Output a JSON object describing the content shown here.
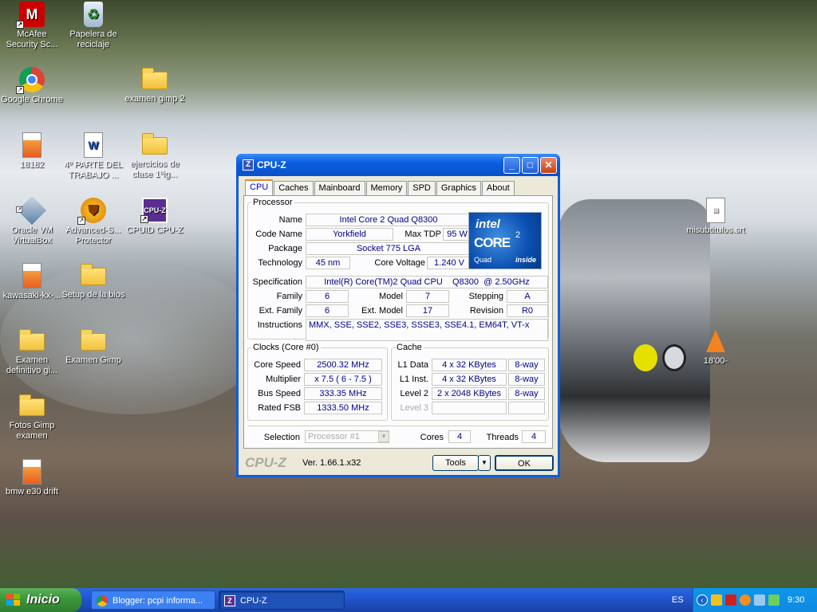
{
  "desktop": {
    "icons": [
      {
        "label": "McAfee Security Sc...",
        "icon": "mcafee-icon"
      },
      {
        "label": "Papelera de reciclaje",
        "icon": "recycle-bin-icon"
      },
      {
        "label": "Google Chrome",
        "icon": "chrome-icon"
      },
      {
        "label": "examen gimp 2",
        "icon": "folder-icon"
      },
      {
        "label": "18182",
        "icon": "image-file-icon"
      },
      {
        "label": "4º PARTE DEL TRABAJO ...",
        "icon": "word-doc-icon"
      },
      {
        "label": "ejercicios de clase 1ºig...",
        "icon": "folder-icon"
      },
      {
        "label": "Oracle VM VirtualBox",
        "icon": "virtualbox-icon"
      },
      {
        "label": "Advanced-S... Protector",
        "icon": "shield-app-icon"
      },
      {
        "label": "CPUID CPU-Z",
        "icon": "cpuz-icon"
      },
      {
        "label": "misubtitulos.srt",
        "icon": "text-file-icon"
      },
      {
        "label": "kawasaki-kx-...",
        "icon": "image-file-icon"
      },
      {
        "label": "Setup de la bios",
        "icon": "folder-icon"
      },
      {
        "label": "18'00-",
        "icon": "vlc-icon"
      },
      {
        "label": "Examen definitivo gi...",
        "icon": "folder-icon"
      },
      {
        "label": "Examen Gimp",
        "icon": "folder-icon"
      },
      {
        "label": "Fotos Gimp examen",
        "icon": "folder-icon"
      },
      {
        "label": "bmw e30 drift",
        "icon": "image-file-icon"
      }
    ]
  },
  "window": {
    "title": "CPU-Z",
    "logo": "Z",
    "tabs": [
      "CPU",
      "Caches",
      "Mainboard",
      "Memory",
      "SPD",
      "Graphics",
      "About"
    ],
    "processor": {
      "legend": "Processor",
      "name_label": "Name",
      "name": "Intel Core 2 Quad Q8300",
      "codename_label": "Code Name",
      "codename": "Yorkfield",
      "maxtdp_label": "Max TDP",
      "maxtdp": "95 W",
      "package_label": "Package",
      "package": "Socket 775 LGA",
      "technology_label": "Technology",
      "technology": "45 nm",
      "voltage_label": "Core Voltage",
      "voltage": "1.240 V",
      "spec_label": "Specification",
      "spec": "Intel(R) Core(TM)2 Quad CPU    Q8300  @ 2.50GHz",
      "family_label": "Family",
      "family": "6",
      "model_label": "Model",
      "model": "7",
      "stepping_label": "Stepping",
      "stepping": "A",
      "extfamily_label": "Ext. Family",
      "extfamily": "6",
      "extmodel_label": "Ext. Model",
      "extmodel": "17",
      "revision_label": "Revision",
      "revision": "R0",
      "instructions_label": "Instructions",
      "instructions": "MMX, SSE, SSE2, SSE3, SSSE3, SSE4.1, EM64T, VT-x"
    },
    "intel_logo": {
      "brand": "intel",
      "line": "CORE",
      "sup": "2",
      "sub": "Quad",
      "inside": "inside"
    },
    "clocks": {
      "legend": "Clocks (Core #0)",
      "corespeed_label": "Core Speed",
      "corespeed": "2500.32 MHz",
      "multiplier_label": "Multiplier",
      "multiplier": "x 7.5 ( 6 - 7.5 )",
      "busspeed_label": "Bus Speed",
      "busspeed": "333.35 MHz",
      "ratedfsb_label": "Rated FSB",
      "ratedfsb": "1333.50 MHz"
    },
    "cache": {
      "legend": "Cache",
      "l1d_label": "L1 Data",
      "l1d": "4 x 32 KBytes",
      "l1d_way": "8-way",
      "l1i_label": "L1 Inst.",
      "l1i": "4 x 32 KBytes",
      "l1i_way": "8-way",
      "l2_label": "Level 2",
      "l2": "2 x 2048 KBytes",
      "l2_way": "8-way",
      "l3_label": "Level 3"
    },
    "selection": {
      "label": "Selection",
      "value": "Processor #1",
      "cores_label": "Cores",
      "cores": "4",
      "threads_label": "Threads",
      "threads": "4"
    },
    "footer": {
      "brand": "CPU-Z",
      "version": "Ver. 1.66.1.x32",
      "tools": "Tools",
      "ok": "OK"
    }
  },
  "taskbar": {
    "start": "Inicio",
    "tasks": [
      "Blogger: pcpi informa...",
      "CPU-Z"
    ],
    "lang": "ES",
    "clock": "9:30"
  }
}
